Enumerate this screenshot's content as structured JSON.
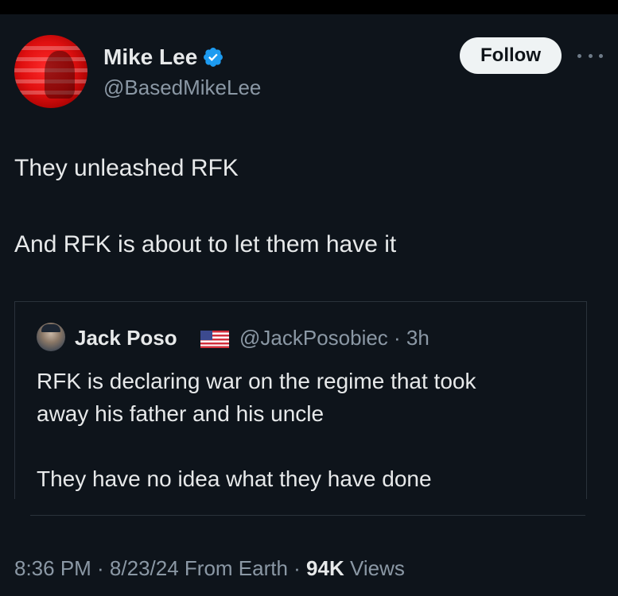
{
  "author": {
    "display_name": "Mike Lee",
    "handle": "@BasedMikeLee",
    "follow_label": "Follow",
    "verified_icon": "verified-badge-icon",
    "more_icon": "more-horizontal-icon"
  },
  "tweet": {
    "lines": [
      "They unleashed RFK",
      "And RFK is about to let them have it"
    ]
  },
  "quote": {
    "display_name": "Jack Poso",
    "flag_icon": "us-flag-icon",
    "meta": "@JackPosobiec · 3h",
    "lines": [
      "RFK is declaring war on the regime that took",
      "away his father and his uncle",
      "They have no idea what they have done"
    ]
  },
  "footer": {
    "timestamp": "8:36 PM · 8/23/24 From Earth · ",
    "views_count": "94K",
    "views_label": " Views"
  },
  "colors": {
    "background": "#0e141b",
    "text_primary": "#e7e9ea",
    "text_secondary": "#8b98a5",
    "verified_blue": "#1d9bf0",
    "follow_button_bg": "#eff3f4"
  }
}
